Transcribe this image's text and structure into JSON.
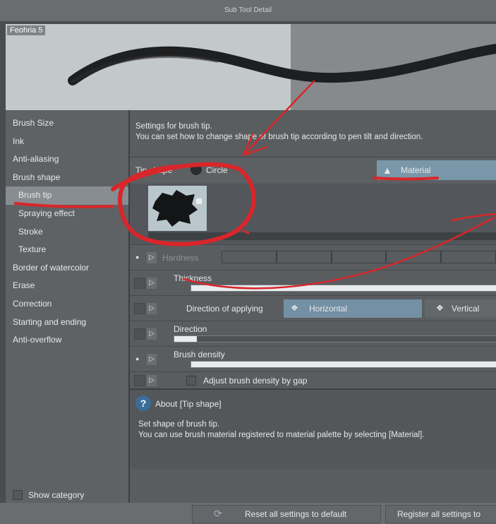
{
  "window": {
    "title": "Sub Tool Detail"
  },
  "preview": {
    "brush_name": "Feohria 5"
  },
  "categories": [
    {
      "label": "Brush Size"
    },
    {
      "label": "Ink"
    },
    {
      "label": "Anti-aliasing"
    },
    {
      "label": "Brush shape"
    },
    {
      "label": "Brush tip"
    },
    {
      "label": "Spraying effect"
    },
    {
      "label": "Stroke"
    },
    {
      "label": "Texture"
    },
    {
      "label": "Border of watercolor"
    },
    {
      "label": "Erase"
    },
    {
      "label": "Correction"
    },
    {
      "label": "Starting and ending"
    },
    {
      "label": "Anti-overflow"
    }
  ],
  "show_category": "Show category",
  "settings": {
    "desc_line1": "Settings for brush tip.",
    "desc_line2": "You can set how to change shape of brush tip according to pen tilt and direction.",
    "tip_shape_label": "Tip shape",
    "circle_label": "Circle",
    "material_label": "Material",
    "hardness_label": "Hardness",
    "thickness_label": "Thickness",
    "direction_applying_label": "Direction of applying",
    "horizontal_label": "Horizontal",
    "vertical_label": "Vertical",
    "direction_label": "Direction",
    "brush_density_label": "Brush density",
    "adjust_density_label": "Adjust brush density by gap",
    "thickness_value": 1.0,
    "direction_value": 0.07,
    "brush_density_value": 1.0
  },
  "about": {
    "title": "About [Tip shape]",
    "line1": "Set shape of brush tip.",
    "line2": "You can use brush material registered to material palette by selecting [Material]."
  },
  "footer": {
    "reset_label": "Reset all settings to default",
    "register_label": "Register all settings to"
  },
  "colors": {
    "annotation": "#d8262a",
    "selection": "#7a97aa"
  }
}
